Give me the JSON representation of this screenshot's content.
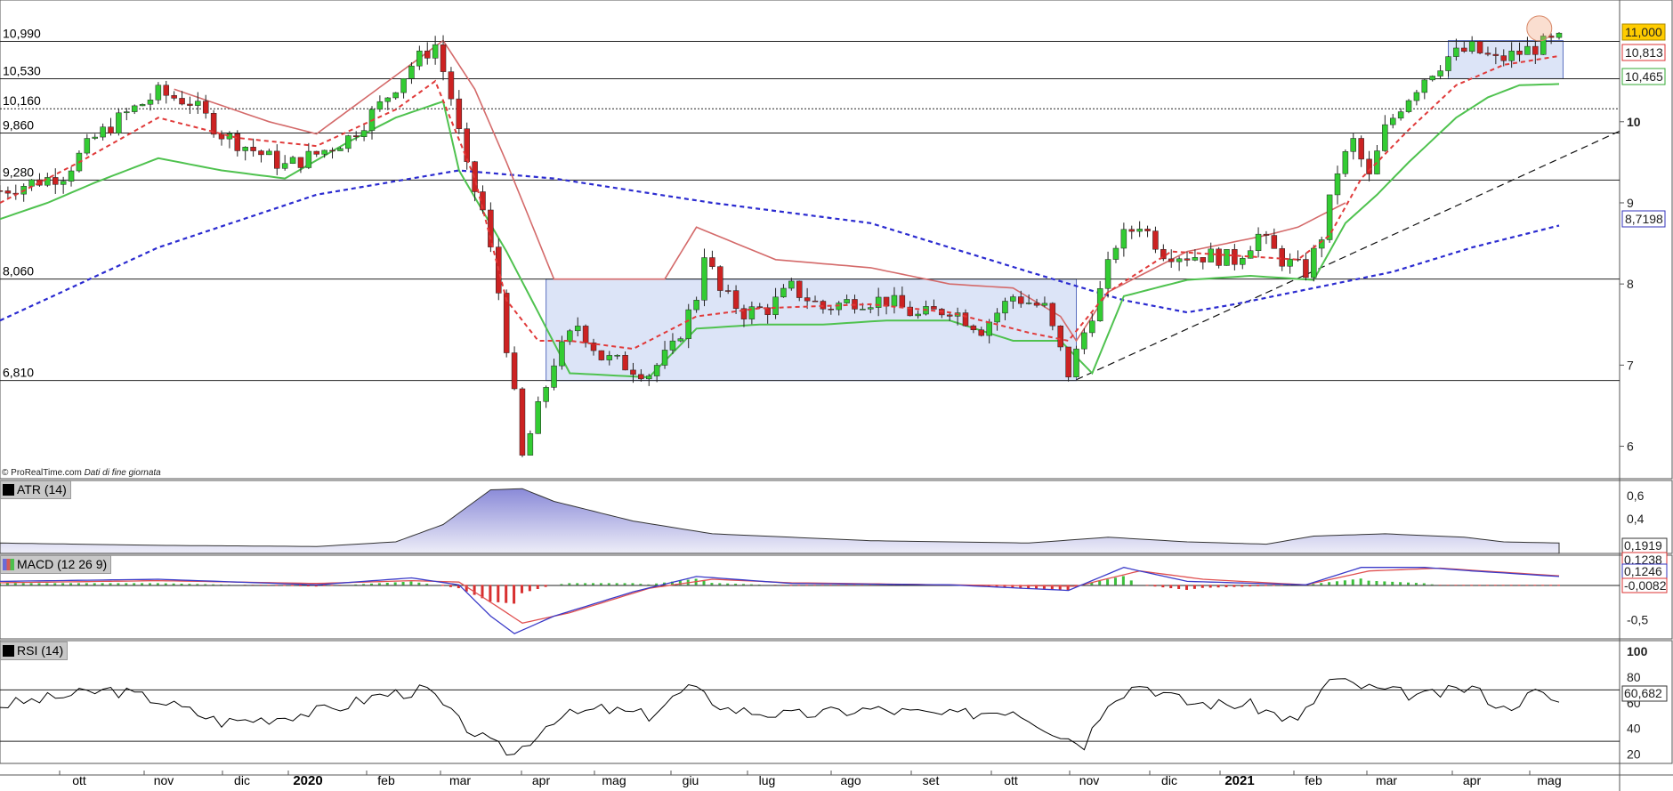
{
  "credit": {
    "source": "© ProRealTime.com",
    "note": "Dati di fine giornata"
  },
  "indicators": {
    "atr_label": "ATR (14)",
    "macd_label": "MACD (12 26 9)",
    "rsi_label": "RSI (14)"
  },
  "colors": {
    "up": "#33cc33",
    "down": "#cc2222",
    "ema": "#e03a3a",
    "stop_green": "#4fc24f",
    "stop_red": "#d46a6a",
    "sma": "#2b2bd0",
    "box": "#dce4f7",
    "box_border": "#5a6fc0",
    "atr_fill": "#b8b8e6",
    "rsi_line": "#000000"
  },
  "chart_data": [
    {
      "type": "candlestick",
      "title": "",
      "x_months": [
        "ott",
        "nov",
        "dic",
        "2020",
        "feb",
        "mar",
        "apr",
        "mag",
        "giu",
        "lug",
        "ago",
        "set",
        "ott",
        "nov",
        "dic",
        "2021",
        "feb",
        "mar",
        "apr",
        "mag"
      ],
      "ylim": [
        5.6,
        11.5
      ],
      "y_ticks": [
        6,
        7,
        8,
        9,
        10
      ],
      "horizontal_levels": [
        {
          "value": 10.99,
          "label": "10,990"
        },
        {
          "value": 10.53,
          "label": "10,530"
        },
        {
          "value": 10.16,
          "label": "10,160",
          "style": "dotted"
        },
        {
          "value": 9.86,
          "label": "9,860"
        },
        {
          "value": 9.28,
          "label": "9,280"
        },
        {
          "value": 8.06,
          "label": "8,060"
        },
        {
          "value": 6.81,
          "label": "6,810"
        }
      ],
      "last_values": [
        {
          "label": "11,000",
          "value": 11.0,
          "series": "price"
        },
        {
          "label": "10,813",
          "value": 10.813,
          "series": "ema"
        },
        {
          "label": "10,465",
          "value": 10.465,
          "series": "stop"
        },
        {
          "label": "8,7198",
          "value": 8.7198,
          "series": "sma"
        }
      ],
      "price_path": [
        [
          0,
          9.15
        ],
        [
          4,
          9.25
        ],
        [
          8,
          9.35
        ],
        [
          12,
          9.8
        ],
        [
          16,
          10.1
        ],
        [
          20,
          10.35
        ],
        [
          24,
          10.25
        ],
        [
          28,
          9.85
        ],
        [
          32,
          9.65
        ],
        [
          36,
          9.45
        ],
        [
          40,
          9.6
        ],
        [
          44,
          9.8
        ],
        [
          48,
          10.2
        ],
        [
          52,
          10.7
        ],
        [
          55,
          10.95
        ],
        [
          57,
          10.3
        ],
        [
          59,
          9.4
        ],
        [
          61,
          8.9
        ],
        [
          63,
          7.9
        ],
        [
          65,
          6.6
        ],
        [
          66,
          5.85
        ],
        [
          68,
          6.45
        ],
        [
          70,
          7.05
        ],
        [
          73,
          7.5
        ],
        [
          76,
          7.1
        ],
        [
          79,
          7.0
        ],
        [
          82,
          6.9
        ],
        [
          85,
          7.2
        ],
        [
          88,
          7.85
        ],
        [
          89,
          8.4
        ],
        [
          91,
          7.9
        ],
        [
          94,
          7.65
        ],
        [
          97,
          7.7
        ],
        [
          100,
          7.95
        ],
        [
          104,
          7.7
        ],
        [
          108,
          7.8
        ],
        [
          112,
          7.8
        ],
        [
          116,
          7.6
        ],
        [
          120,
          7.7
        ],
        [
          124,
          7.45
        ],
        [
          128,
          7.85
        ],
        [
          132,
          7.7
        ],
        [
          135,
          6.9
        ],
        [
          137,
          7.4
        ],
        [
          139,
          7.9
        ],
        [
          141,
          8.5
        ],
        [
          144,
          8.75
        ],
        [
          147,
          8.4
        ],
        [
          150,
          8.35
        ],
        [
          153,
          8.35
        ],
        [
          156,
          8.3
        ],
        [
          159,
          8.6
        ],
        [
          162,
          8.3
        ],
        [
          165,
          8.15
        ],
        [
          167,
          8.6
        ],
        [
          169,
          9.4
        ],
        [
          171,
          9.75
        ],
        [
          173,
          9.3
        ],
        [
          175,
          9.9
        ],
        [
          177,
          10.2
        ],
        [
          180,
          10.55
        ],
        [
          183,
          10.8
        ],
        [
          186,
          10.9
        ],
        [
          189,
          10.75
        ],
        [
          192,
          10.85
        ],
        [
          195,
          10.95
        ],
        [
          197,
          11.0
        ]
      ],
      "ema_path": [
        [
          0,
          9.0
        ],
        [
          10,
          9.5
        ],
        [
          20,
          10.05
        ],
        [
          30,
          9.8
        ],
        [
          40,
          9.7
        ],
        [
          50,
          10.15
        ],
        [
          55,
          10.5
        ],
        [
          60,
          9.3
        ],
        [
          64,
          7.8
        ],
        [
          68,
          7.3
        ],
        [
          72,
          7.3
        ],
        [
          80,
          7.2
        ],
        [
          88,
          7.6
        ],
        [
          96,
          7.7
        ],
        [
          110,
          7.75
        ],
        [
          120,
          7.65
        ],
        [
          130,
          7.4
        ],
        [
          135,
          7.3
        ],
        [
          140,
          7.9
        ],
        [
          148,
          8.4
        ],
        [
          156,
          8.35
        ],
        [
          164,
          8.3
        ],
        [
          168,
          8.6
        ],
        [
          172,
          9.3
        ],
        [
          178,
          9.9
        ],
        [
          184,
          10.45
        ],
        [
          190,
          10.7
        ],
        [
          197,
          10.81
        ]
      ],
      "stop_path": [
        [
          0,
          8.8
        ],
        [
          6,
          9.0
        ],
        [
          12,
          9.25
        ],
        [
          20,
          9.55
        ],
        [
          28,
          9.4
        ],
        [
          36,
          9.3
        ],
        [
          44,
          9.75
        ],
        [
          50,
          10.05
        ],
        [
          56,
          10.25
        ],
        [
          58,
          9.4
        ],
        [
          64,
          8.4
        ],
        [
          72,
          6.9
        ],
        [
          82,
          6.85
        ],
        [
          88,
          7.45
        ],
        [
          96,
          7.5
        ],
        [
          104,
          7.5
        ],
        [
          112,
          7.55
        ],
        [
          120,
          7.55
        ],
        [
          128,
          7.3
        ],
        [
          134,
          7.3
        ],
        [
          138,
          6.9
        ],
        [
          142,
          7.85
        ],
        [
          150,
          8.05
        ],
        [
          158,
          8.1
        ],
        [
          166,
          8.05
        ],
        [
          170,
          8.75
        ],
        [
          174,
          9.1
        ],
        [
          178,
          9.5
        ],
        [
          184,
          10.05
        ],
        [
          188,
          10.3
        ],
        [
          192,
          10.45
        ],
        [
          197,
          10.465
        ]
      ],
      "sma_path": [
        [
          0,
          7.55
        ],
        [
          20,
          8.45
        ],
        [
          40,
          9.1
        ],
        [
          58,
          9.4
        ],
        [
          70,
          9.3
        ],
        [
          90,
          9.0
        ],
        [
          110,
          8.75
        ],
        [
          130,
          8.15
        ],
        [
          142,
          7.8
        ],
        [
          150,
          7.65
        ],
        [
          156,
          7.75
        ],
        [
          166,
          7.95
        ],
        [
          176,
          8.15
        ],
        [
          186,
          8.45
        ],
        [
          197,
          8.72
        ]
      ],
      "trendline": [
        [
          136,
          6.82
        ],
        [
          205,
          9.9
        ]
      ]
    },
    {
      "type": "area",
      "name": "ATR (14)",
      "ylim": [
        0.1,
        0.7
      ],
      "y_ticks": [
        {
          "value": 0.6,
          "label": "0,6"
        },
        {
          "value": 0.4,
          "label": "0,4"
        }
      ],
      "last_value": {
        "label": "0,1919",
        "value": 0.1919
      },
      "points": [
        [
          0,
          0.19
        ],
        [
          20,
          0.17
        ],
        [
          40,
          0.16
        ],
        [
          50,
          0.2
        ],
        [
          56,
          0.35
        ],
        [
          62,
          0.65
        ],
        [
          66,
          0.66
        ],
        [
          70,
          0.55
        ],
        [
          80,
          0.38
        ],
        [
          90,
          0.27
        ],
        [
          110,
          0.21
        ],
        [
          130,
          0.19
        ],
        [
          140,
          0.24
        ],
        [
          150,
          0.2
        ],
        [
          160,
          0.18
        ],
        [
          166,
          0.25
        ],
        [
          175,
          0.27
        ],
        [
          185,
          0.24
        ],
        [
          190,
          0.2
        ],
        [
          197,
          0.19
        ]
      ]
    },
    {
      "type": "line",
      "name": "MACD (12 26 9)",
      "ylim": [
        -0.75,
        0.4
      ],
      "y_ticks": [
        {
          "value": -0.5,
          "label": "-0,5"
        }
      ],
      "last_values": [
        {
          "label": "0,1238",
          "value": 0.1238
        },
        {
          "label": "0,1246",
          "value": 0.1246
        },
        {
          "label": "-0,0082",
          "value": -0.0082
        }
      ],
      "macd": [
        [
          0,
          0.05
        ],
        [
          20,
          0.08
        ],
        [
          40,
          0.0
        ],
        [
          52,
          0.1
        ],
        [
          58,
          0.0
        ],
        [
          62,
          -0.45
        ],
        [
          65,
          -0.7
        ],
        [
          70,
          -0.45
        ],
        [
          80,
          -0.1
        ],
        [
          88,
          0.12
        ],
        [
          100,
          0.02
        ],
        [
          120,
          0.0
        ],
        [
          135,
          -0.08
        ],
        [
          142,
          0.25
        ],
        [
          150,
          0.05
        ],
        [
          165,
          0.0
        ],
        [
          172,
          0.25
        ],
        [
          180,
          0.25
        ],
        [
          186,
          0.2
        ],
        [
          197,
          0.12
        ]
      ],
      "signal": [
        [
          0,
          0.03
        ],
        [
          20,
          0.06
        ],
        [
          40,
          0.02
        ],
        [
          52,
          0.06
        ],
        [
          58,
          0.04
        ],
        [
          62,
          -0.25
        ],
        [
          66,
          -0.55
        ],
        [
          72,
          -0.4
        ],
        [
          82,
          -0.05
        ],
        [
          90,
          0.08
        ],
        [
          100,
          0.03
        ],
        [
          120,
          0.0
        ],
        [
          136,
          -0.02
        ],
        [
          144,
          0.2
        ],
        [
          152,
          0.08
        ],
        [
          165,
          0.0
        ],
        [
          173,
          0.2
        ],
        [
          182,
          0.24
        ],
        [
          190,
          0.18
        ],
        [
          197,
          0.13
        ]
      ]
    },
    {
      "type": "line",
      "name": "RSI (14)",
      "ylim": [
        10,
        100
      ],
      "y_ticks": [
        {
          "value": 100,
          "label": "100"
        },
        {
          "value": 80,
          "label": "80"
        },
        {
          "value": 60,
          "label": "60"
        },
        {
          "value": 40,
          "label": "40"
        },
        {
          "value": 20,
          "label": "20"
        }
      ],
      "levels": [
        70,
        30
      ],
      "last_value": {
        "label": "60,682",
        "value": 60.682
      },
      "points": [
        [
          0,
          58
        ],
        [
          8,
          65
        ],
        [
          14,
          70
        ],
        [
          20,
          62
        ],
        [
          28,
          45
        ],
        [
          34,
          48
        ],
        [
          42,
          55
        ],
        [
          48,
          66
        ],
        [
          54,
          70
        ],
        [
          58,
          45
        ],
        [
          62,
          28
        ],
        [
          65,
          20
        ],
        [
          70,
          48
        ],
        [
          76,
          55
        ],
        [
          82,
          50
        ],
        [
          87,
          72
        ],
        [
          92,
          55
        ],
        [
          100,
          50
        ],
        [
          110,
          55
        ],
        [
          120,
          50
        ],
        [
          128,
          55
        ],
        [
          134,
          35
        ],
        [
          137,
          28
        ],
        [
          140,
          62
        ],
        [
          144,
          75
        ],
        [
          150,
          60
        ],
        [
          158,
          58
        ],
        [
          164,
          45
        ],
        [
          168,
          78
        ],
        [
          174,
          70
        ],
        [
          180,
          65
        ],
        [
          186,
          72
        ],
        [
          190,
          55
        ],
        [
          194,
          68
        ],
        [
          197,
          60.7
        ]
      ]
    }
  ]
}
